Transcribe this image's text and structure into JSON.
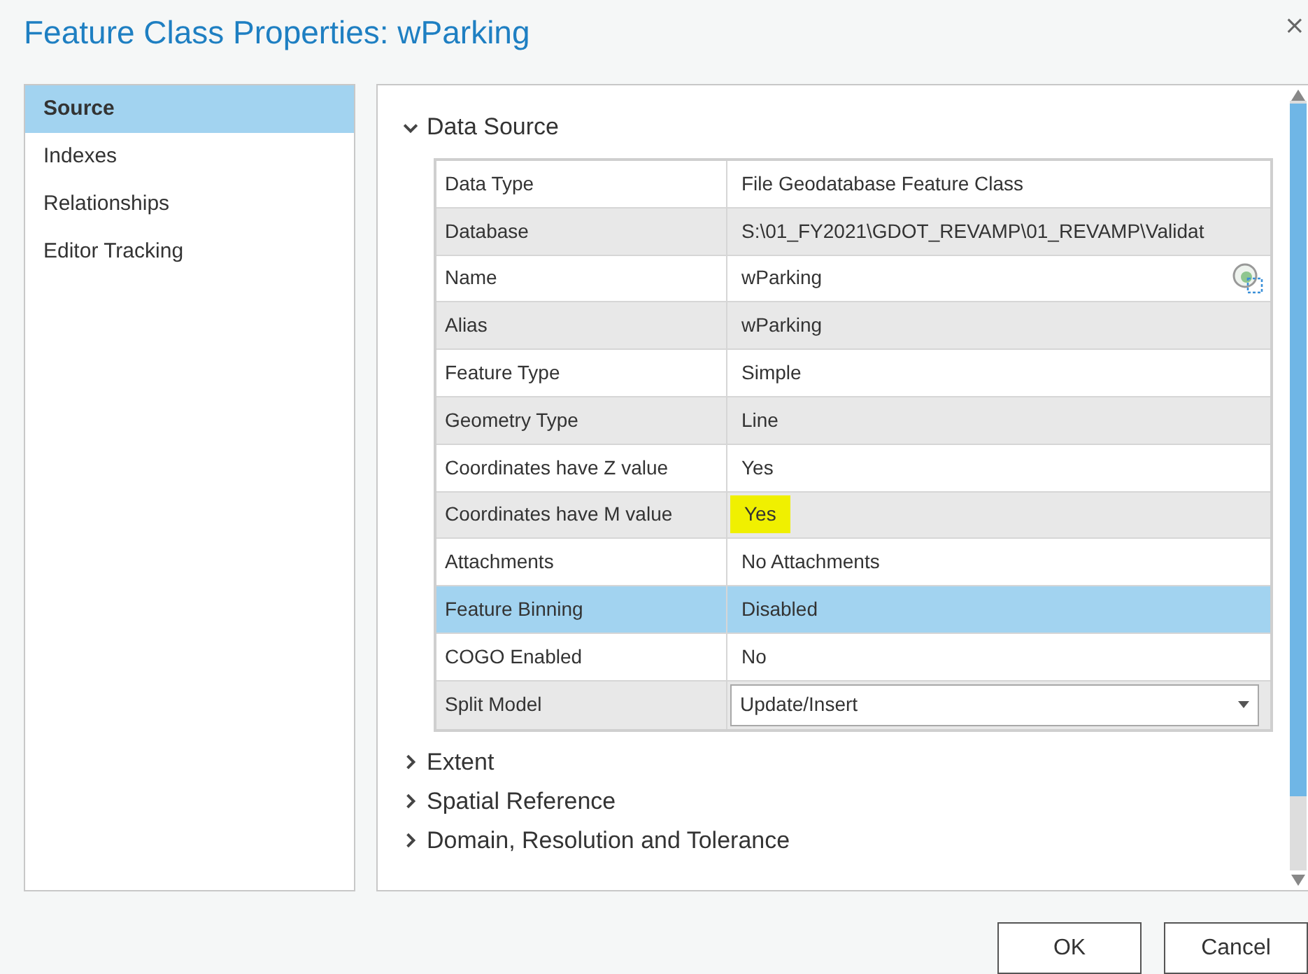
{
  "window": {
    "title": "Feature Class Properties: wParking",
    "close": "×"
  },
  "sidebar": {
    "items": [
      {
        "label": "Source",
        "selected": true
      },
      {
        "label": "Indexes",
        "selected": false
      },
      {
        "label": "Relationships",
        "selected": false
      },
      {
        "label": "Editor Tracking",
        "selected": false
      }
    ]
  },
  "sections": [
    {
      "title": "Data Source",
      "expanded": true,
      "rows": [
        {
          "kind": "text",
          "label": "Data Type",
          "value": "File Geodatabase Feature Class",
          "selected": false,
          "highlighted": false
        },
        {
          "kind": "text",
          "label": "Database",
          "value": "S:\\01_FY2021\\GDOT_REVAMP\\01_REVAMP\\Validat",
          "selected": false,
          "highlighted": false
        },
        {
          "kind": "icon",
          "label": "Name",
          "value": "wParking",
          "selected": false,
          "highlighted": false
        },
        {
          "kind": "text",
          "label": "Alias",
          "value": "wParking",
          "selected": false,
          "highlighted": false
        },
        {
          "kind": "text",
          "label": "Feature Type",
          "value": "Simple",
          "selected": false,
          "highlighted": false
        },
        {
          "kind": "text",
          "label": "Geometry Type",
          "value": "Line",
          "selected": false,
          "highlighted": false
        },
        {
          "kind": "text",
          "label": "Coordinates have Z value",
          "value": "Yes",
          "selected": false,
          "highlighted": false
        },
        {
          "kind": "text",
          "label": "Coordinates have M value",
          "value": "Yes",
          "selected": false,
          "highlighted": true
        },
        {
          "kind": "text",
          "label": "Attachments",
          "value": "No Attachments",
          "selected": false,
          "highlighted": false
        },
        {
          "kind": "text",
          "label": "Feature Binning",
          "value": "Disabled",
          "selected": true,
          "highlighted": false
        },
        {
          "kind": "text",
          "label": "COGO Enabled",
          "value": "No",
          "selected": false,
          "highlighted": false
        },
        {
          "kind": "dropdown",
          "label": "Split Model",
          "value": "Update/Insert",
          "selected": false
        }
      ]
    },
    {
      "title": "Extent",
      "expanded": false
    },
    {
      "title": "Spatial Reference",
      "expanded": false
    },
    {
      "title": "Domain, Resolution and Tolerance",
      "expanded": false
    }
  ],
  "buttons": [
    "OK",
    "Cancel"
  ]
}
